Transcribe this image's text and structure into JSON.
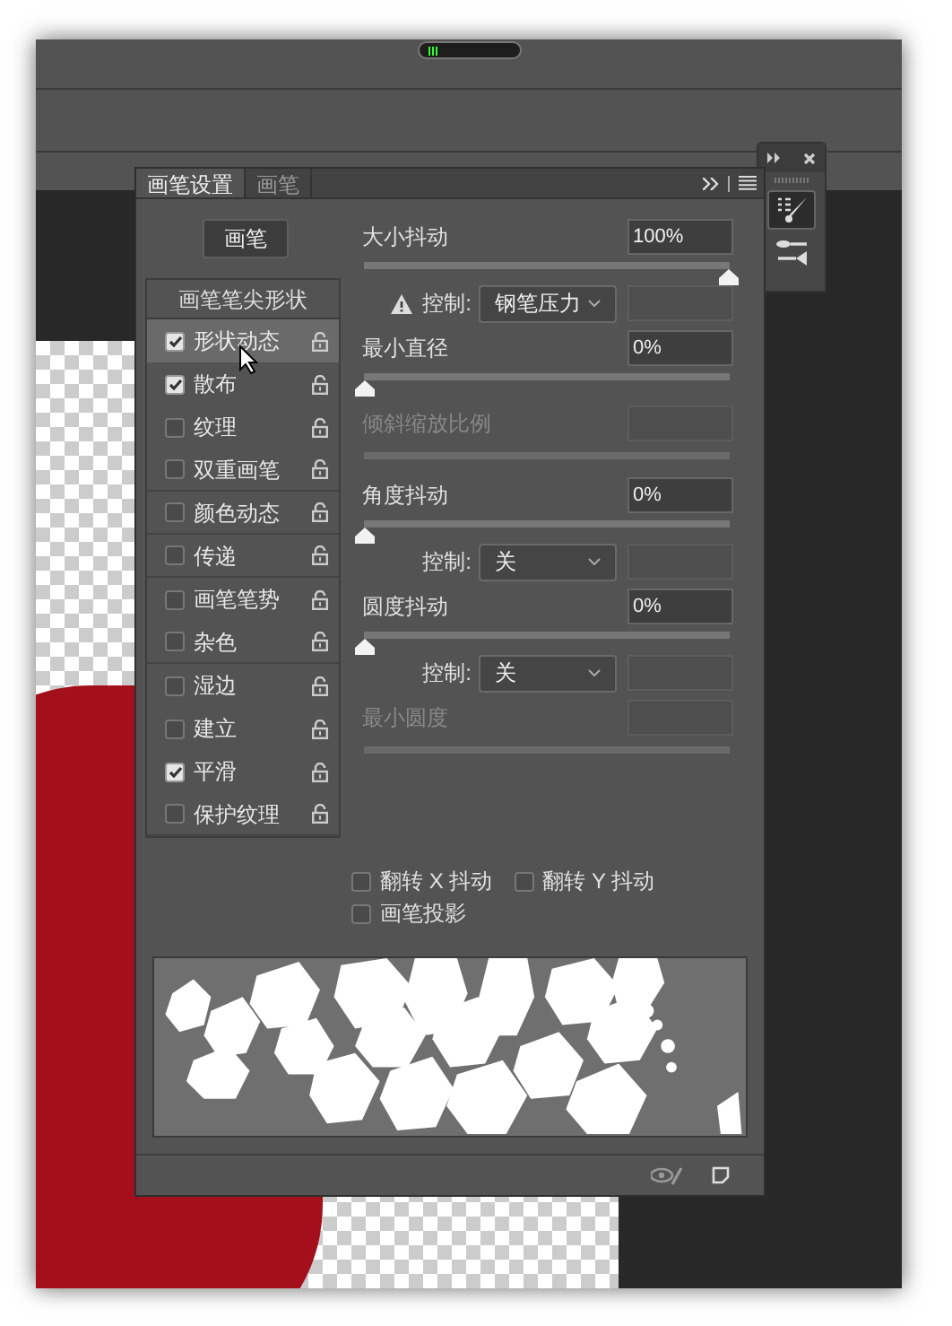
{
  "tabs": [
    {
      "label": "画笔设置",
      "selected": true
    },
    {
      "label": "画笔",
      "selected": false
    }
  ],
  "brush_button": "画笔",
  "tip_shape_heading": "画笔笔尖形状",
  "options": [
    {
      "label": "形状动态",
      "checked": true,
      "selected": true
    },
    {
      "label": "散布",
      "checked": true,
      "selected": false
    },
    {
      "label": "纹理",
      "checked": false,
      "selected": false
    },
    {
      "label": "双重画笔",
      "checked": false,
      "selected": false
    },
    {
      "label": "颜色动态",
      "checked": false,
      "selected": false
    },
    {
      "label": "传递",
      "checked": false,
      "selected": false
    },
    {
      "label": "画笔笔势",
      "checked": false,
      "selected": false
    },
    {
      "label": "杂色",
      "checked": false,
      "selected": false
    },
    {
      "label": "湿边",
      "checked": false,
      "selected": false
    },
    {
      "label": "建立",
      "checked": false,
      "selected": false
    },
    {
      "label": "平滑",
      "checked": true,
      "selected": false
    },
    {
      "label": "保护纹理",
      "checked": false,
      "selected": false
    }
  ],
  "settings": [
    {
      "kind": "slider",
      "label": "大小抖动",
      "value": "100%",
      "level": 1
    },
    {
      "kind": "control",
      "label": "控制:",
      "value": "钢笔压力",
      "warning": true
    },
    {
      "kind": "slider",
      "label": "最小直径",
      "value": "0%",
      "level": 0
    },
    {
      "kind": "disabled",
      "label": "倾斜缩放比例"
    },
    {
      "kind": "slider",
      "label": "角度抖动",
      "value": "0%",
      "level": 0
    },
    {
      "kind": "control",
      "label": "控制:",
      "value": "关",
      "warning": false
    },
    {
      "kind": "slider",
      "label": "圆度抖动",
      "value": "0%",
      "level": 0
    },
    {
      "kind": "control",
      "label": "控制:",
      "value": "关",
      "warning": false
    },
    {
      "kind": "disabled",
      "label": "最小圆度"
    }
  ],
  "flip_options": [
    {
      "label": "翻转 X 抖动",
      "checked": false
    },
    {
      "label": "翻转 Y 抖动",
      "checked": false
    },
    {
      "label": "画笔投影",
      "checked": false
    }
  ]
}
